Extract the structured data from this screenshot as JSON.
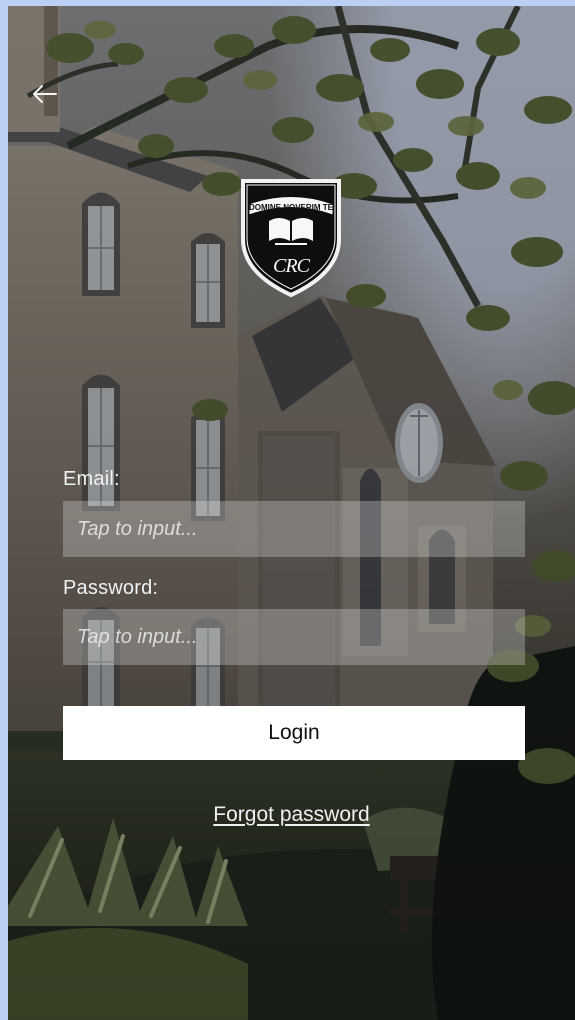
{
  "screen": {
    "background_scene": "school-building-with-trees",
    "colors": {
      "page_bg": "#bcd0f5",
      "field_bg": "rgba(230,230,230,0.30)",
      "login_bg": "#ffffff",
      "text_light": "#f1f1f1"
    }
  },
  "header": {
    "back_icon": "arrow-left-icon"
  },
  "logo": {
    "motto": "DOMINE NOVERIM TE",
    "monogram": "CRC"
  },
  "form": {
    "email_label": "Email:",
    "email_placeholder": "Tap to input...",
    "password_label": "Password:",
    "password_placeholder": "Tap to input...",
    "login_label": "Login",
    "forgot_password_label": "Forgot password"
  }
}
